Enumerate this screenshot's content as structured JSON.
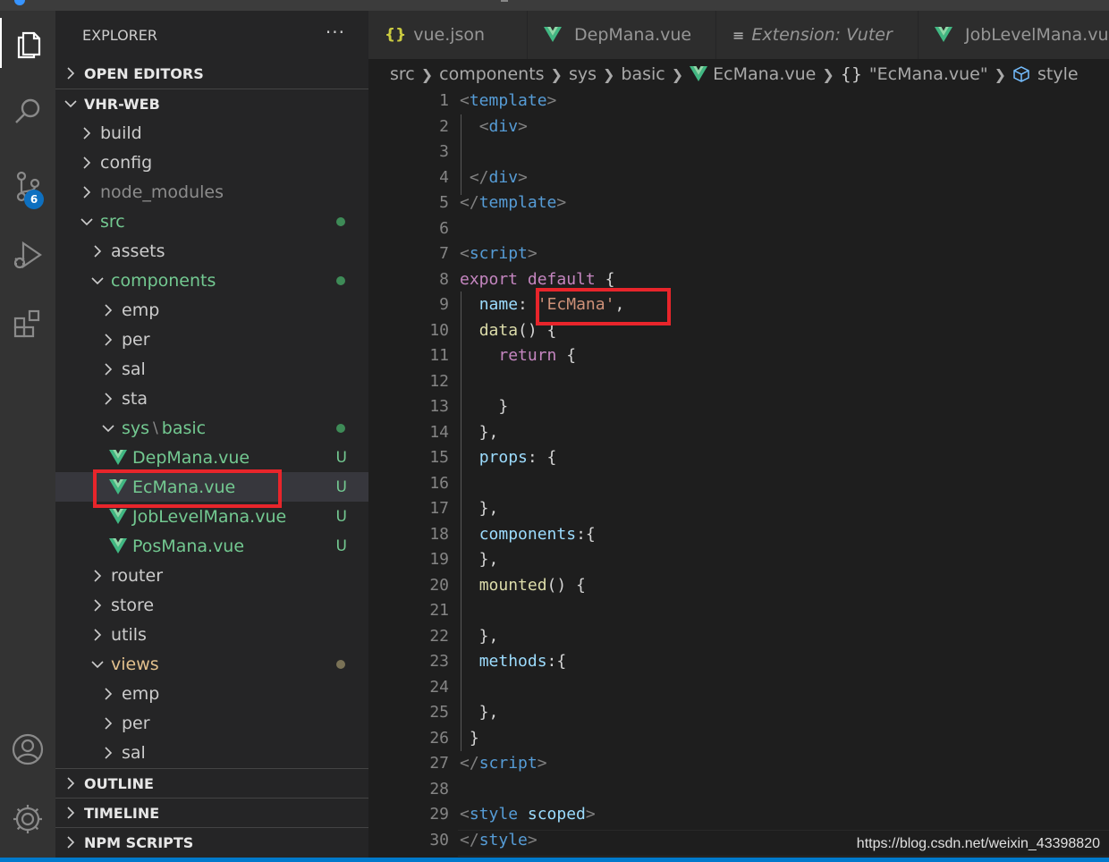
{
  "sidebar": {
    "title": "EXPLORER",
    "more": "···",
    "sections": {
      "open_editors": "OPEN EDITORS",
      "project": "VHR-WEB",
      "outline": "OUTLINE",
      "timeline": "TIMELINE",
      "npm_scripts": "NPM SCRIPTS"
    },
    "tree": [
      {
        "label": "build",
        "type": "folder",
        "depth": 1,
        "expanded": false
      },
      {
        "label": "config",
        "type": "folder",
        "depth": 1,
        "expanded": false
      },
      {
        "label": "node_modules",
        "type": "folder",
        "depth": 1,
        "expanded": false,
        "muted": true
      },
      {
        "label": "src",
        "type": "folder",
        "depth": 1,
        "expanded": true,
        "color": "green",
        "dot": "green"
      },
      {
        "label": "assets",
        "type": "folder",
        "depth": 2,
        "expanded": false
      },
      {
        "label": "components",
        "type": "folder",
        "depth": 2,
        "expanded": true,
        "color": "green",
        "dot": "green"
      },
      {
        "label": "emp",
        "type": "folder",
        "depth": 3,
        "expanded": false
      },
      {
        "label": "per",
        "type": "folder",
        "depth": 3,
        "expanded": false
      },
      {
        "label": "sal",
        "type": "folder",
        "depth": 3,
        "expanded": false
      },
      {
        "label": "sta",
        "type": "folder",
        "depth": 3,
        "expanded": false
      },
      {
        "label": "sys",
        "label2": "basic",
        "type": "folder",
        "depth": 3,
        "expanded": true,
        "color": "green",
        "dot": "green"
      },
      {
        "label": "DepMana.vue",
        "type": "vue",
        "depth": 4,
        "color": "green",
        "status": "U"
      },
      {
        "label": "EcMana.vue",
        "type": "vue",
        "depth": 4,
        "color": "green",
        "status": "U",
        "selected": true
      },
      {
        "label": "JobLevelMana.vue",
        "type": "vue",
        "depth": 4,
        "color": "green",
        "status": "U"
      },
      {
        "label": "PosMana.vue",
        "type": "vue",
        "depth": 4,
        "color": "green",
        "status": "U"
      },
      {
        "label": "router",
        "type": "folder",
        "depth": 2,
        "expanded": false
      },
      {
        "label": "store",
        "type": "folder",
        "depth": 2,
        "expanded": false
      },
      {
        "label": "utils",
        "type": "folder",
        "depth": 2,
        "expanded": false
      },
      {
        "label": "views",
        "type": "folder",
        "depth": 2,
        "expanded": true,
        "color": "gold",
        "dot": "gold"
      },
      {
        "label": "emp",
        "type": "folder",
        "depth": 3,
        "expanded": false
      },
      {
        "label": "per",
        "type": "folder",
        "depth": 3,
        "expanded": false
      },
      {
        "label": "sal",
        "type": "folder",
        "depth": 3,
        "expanded": false
      }
    ]
  },
  "activity": {
    "scm_badge": "6"
  },
  "tabs": [
    {
      "label": "vue.json",
      "icon": "json-braces-icon"
    },
    {
      "label": "DepMana.vue",
      "icon": "vue-icon"
    },
    {
      "label": "Extension: Vuter",
      "icon": "extension-list-icon"
    },
    {
      "label": "JobLevelMana.vue",
      "icon": "vue-icon"
    }
  ],
  "breadcrumb": {
    "items": [
      "src",
      "components",
      "sys",
      "basic",
      "EcMana.vue",
      "\"EcMana.vue\"",
      "style"
    ],
    "braces": "{}"
  },
  "editor": {
    "line_numbers": [
      "1",
      "2",
      "3",
      "4",
      "5",
      "6",
      "7",
      "8",
      "9",
      "10",
      "11",
      "12",
      "13",
      "14",
      "15",
      "16",
      "17",
      "18",
      "19",
      "20",
      "21",
      "22",
      "23",
      "24",
      "25",
      "26",
      "27",
      "28",
      "29",
      "30"
    ],
    "lines": [
      [
        {
          "t": "<",
          "c": "t-br"
        },
        {
          "t": "template",
          "c": "t-tag"
        },
        {
          "t": ">",
          "c": "t-br"
        }
      ],
      [
        {
          "t": "  "
        },
        {
          "t": "<",
          "c": "t-br"
        },
        {
          "t": "div",
          "c": "t-tag"
        },
        {
          "t": ">",
          "c": "t-br"
        }
      ],
      [],
      [
        {
          "t": " "
        },
        {
          "t": "</",
          "c": "t-br"
        },
        {
          "t": "div",
          "c": "t-tag"
        },
        {
          "t": ">",
          "c": "t-br"
        }
      ],
      [
        {
          "t": "</",
          "c": "t-br"
        },
        {
          "t": "template",
          "c": "t-tag"
        },
        {
          "t": ">",
          "c": "t-br"
        }
      ],
      [],
      [
        {
          "t": "<",
          "c": "t-br"
        },
        {
          "t": "script",
          "c": "t-tag"
        },
        {
          "t": ">",
          "c": "t-br"
        }
      ],
      [
        {
          "t": "export",
          "c": "t-kw"
        },
        {
          "t": " "
        },
        {
          "t": "default",
          "c": "t-kw"
        },
        {
          "t": " {"
        }
      ],
      [
        {
          "t": "  "
        },
        {
          "t": "name",
          "c": "t-prop"
        },
        {
          "t": ": "
        },
        {
          "t": "'EcMana'",
          "c": "t-str"
        },
        {
          "t": ","
        }
      ],
      [
        {
          "t": "  "
        },
        {
          "t": "data",
          "c": "t-fn"
        },
        {
          "t": "() {"
        }
      ],
      [
        {
          "t": "    "
        },
        {
          "t": "return",
          "c": "t-kw"
        },
        {
          "t": " {"
        }
      ],
      [],
      [
        {
          "t": "    }"
        }
      ],
      [
        {
          "t": "  },"
        }
      ],
      [
        {
          "t": "  "
        },
        {
          "t": "props",
          "c": "t-prop"
        },
        {
          "t": ": {"
        }
      ],
      [],
      [
        {
          "t": "  },"
        }
      ],
      [
        {
          "t": "  "
        },
        {
          "t": "components",
          "c": "t-prop"
        },
        {
          "t": ":{"
        }
      ],
      [
        {
          "t": "  },"
        }
      ],
      [
        {
          "t": "  "
        },
        {
          "t": "mounted",
          "c": "t-fn"
        },
        {
          "t": "() {"
        }
      ],
      [],
      [
        {
          "t": "  },"
        }
      ],
      [
        {
          "t": "  "
        },
        {
          "t": "methods",
          "c": "t-prop"
        },
        {
          "t": ":{"
        }
      ],
      [],
      [
        {
          "t": "  },"
        }
      ],
      [
        {
          "t": " }"
        }
      ],
      [
        {
          "t": "</",
          "c": "t-br"
        },
        {
          "t": "script",
          "c": "t-tag"
        },
        {
          "t": ">",
          "c": "t-br"
        }
      ],
      [],
      [
        {
          "t": "<",
          "c": "t-br"
        },
        {
          "t": "style",
          "c": "t-tag"
        },
        {
          "t": " "
        },
        {
          "t": "scoped",
          "c": "t-attr"
        },
        {
          "t": ">",
          "c": "t-br"
        }
      ],
      [
        {
          "t": "</",
          "c": "t-br"
        },
        {
          "t": "style",
          "c": "t-tag"
        },
        {
          "t": ">",
          "c": "t-br"
        }
      ]
    ]
  },
  "watermark": "https://blog.csdn.net/weixin_43398820",
  "colors": {
    "accent": "#007acc",
    "highlight_box": "#e8252b",
    "vue_green": "#41b883"
  }
}
